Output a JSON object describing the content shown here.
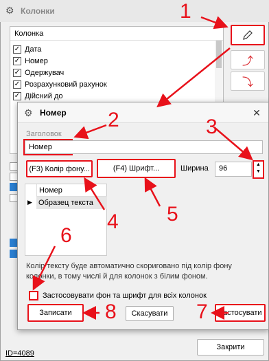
{
  "main_window": {
    "title": "Колонки",
    "list_header": "Колонка",
    "list_items": [
      "Дата",
      "Номер",
      "Одержувач",
      "Розрахунковий рахунок",
      "Дійсний до"
    ],
    "close_button": "Закрити",
    "id_link": "ID=4089"
  },
  "dialog": {
    "title": "Номер",
    "header_label": "Заголовок",
    "header_value": "Номер",
    "color_button": "(F3) Колір фону...",
    "font_button": "(F4) Шрифт...",
    "width_label": "Ширина",
    "width_value": "96",
    "preview_header": "Номер",
    "preview_row": "Образец текста",
    "info_text": "Колір тексту буде автоматично скориговано під колір фону колонки, в тому числі й для колонок з білим фоном.",
    "apply_all_label": "Застосовувати фон та шрифт для всіх колонок",
    "save_button": "Записати",
    "cancel_button": "Скасувати",
    "apply_button": "Застосувати"
  },
  "annotations": [
    "1",
    "2",
    "3",
    "4",
    "5",
    "6",
    "7",
    "8"
  ],
  "colors": {
    "annotation_red": "#e8111a",
    "accent_blue": "#2a7fd1"
  }
}
